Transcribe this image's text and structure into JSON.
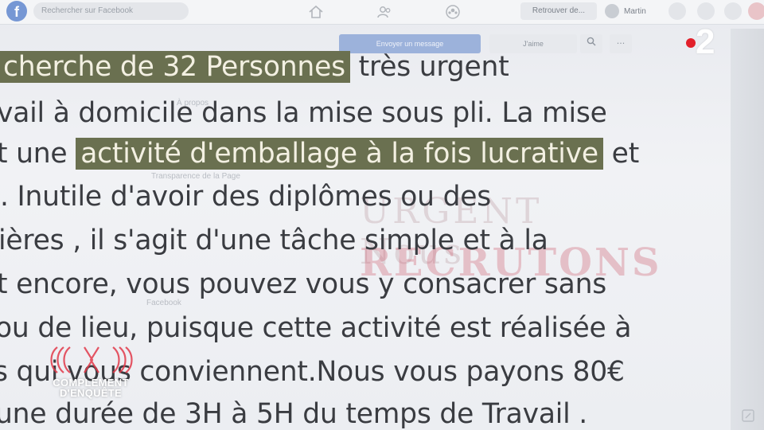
{
  "browser": {
    "search_placeholder": "Rechercher sur Facebook",
    "find_friends_label": "Retrouver de...",
    "profile_name": "Martin"
  },
  "page": {
    "send_message_label": "Envoyer un message",
    "like_label": "J'aime",
    "search_icon": "magnifier-icon",
    "more_label": "···",
    "ghost_texts": {
      "about": "À propos",
      "transparency": "Transparence de la Page",
      "facebook": "Facebook"
    }
  },
  "watermark": {
    "line1": "URGENT Nous",
    "line2": "RECRUTONS"
  },
  "post": {
    "lines": [
      {
        "highlight": "cherche de 32 Personnes",
        "after": " très urgent"
      },
      {
        "text": "vail à domicile dans la mise sous pli. La mise"
      },
      {
        "before": "t une ",
        "highlight": "activité d'emballage à la fois lucrative",
        "after": " et"
      },
      {
        "text": ". Inutile d'avoir des diplômes ou des"
      },
      {
        "text": "ières , il s'agit d'une tâche simple et à la"
      },
      {
        "text": "t encore, vous pouvez vous y consacrer sans"
      },
      {
        "text": "ou de lieu, puisque cette activité  est réalisée à"
      },
      {
        "text": "s qui vous conviennent.Nous vous payons 80€"
      },
      {
        "text": "une durée de 3H à 5H du temps de Travail ."
      }
    ],
    "highlight_color": "#6a7050"
  },
  "overlay": {
    "channel_number": "2",
    "channel_dot_color": "#e2202a",
    "show_name_line1": "COMPLEMENT",
    "show_name_line2": "D'ENQUÊTE"
  }
}
